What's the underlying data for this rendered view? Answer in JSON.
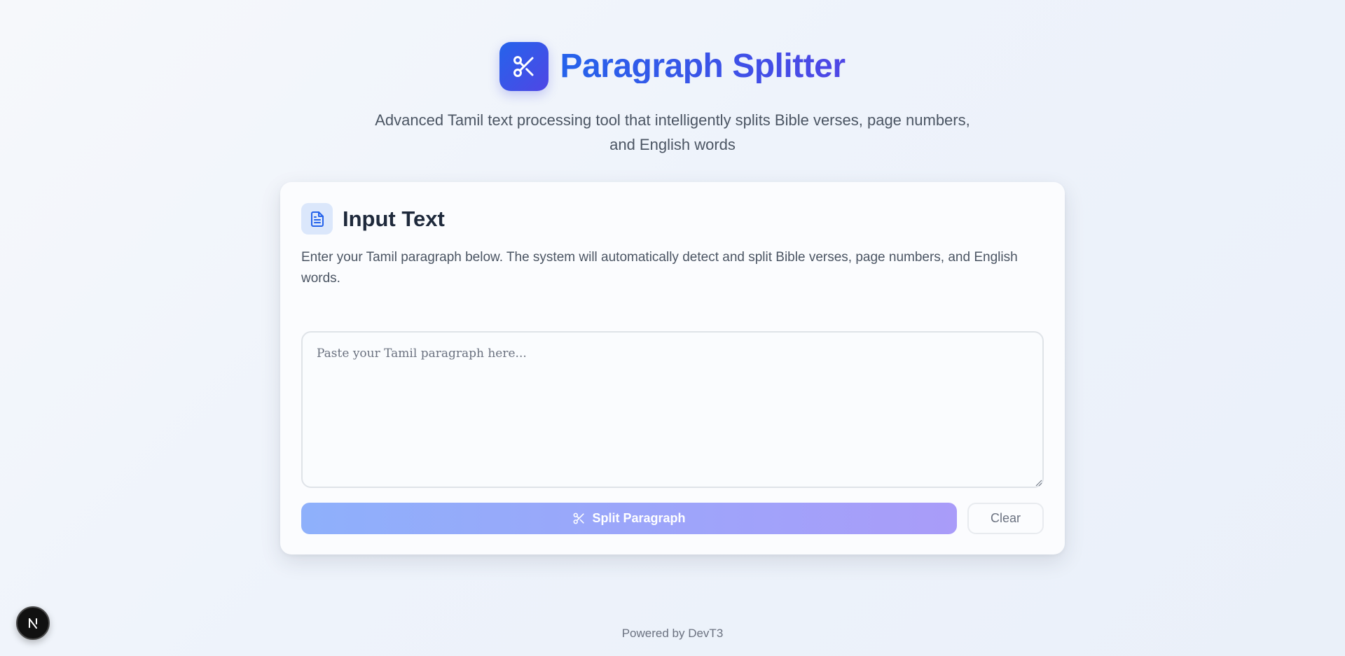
{
  "header": {
    "logo_icon": "scissors-icon",
    "title": "Paragraph Splitter",
    "subtitle": "Advanced Tamil text processing tool that intelligently splits Bible verses, page numbers, and English words"
  },
  "card": {
    "icon": "document-icon",
    "title": "Input Text",
    "description": "Enter your Tamil paragraph below. The system will automatically detect and split Bible verses, page numbers, and English words.",
    "textarea": {
      "value": "",
      "placeholder": "Paste your Tamil paragraph here..."
    },
    "split_button": {
      "icon": "scissors-icon",
      "label": "Split Paragraph"
    },
    "clear_button": {
      "label": "Clear"
    }
  },
  "footer": {
    "text": "Powered by DevT3"
  },
  "dev_badge": {
    "icon": "n-logo-icon"
  },
  "colors": {
    "accent_start": "#2563eb",
    "accent_end": "#4f46e5",
    "button_start": "#8eb0fb",
    "button_end": "#a99cf9"
  }
}
